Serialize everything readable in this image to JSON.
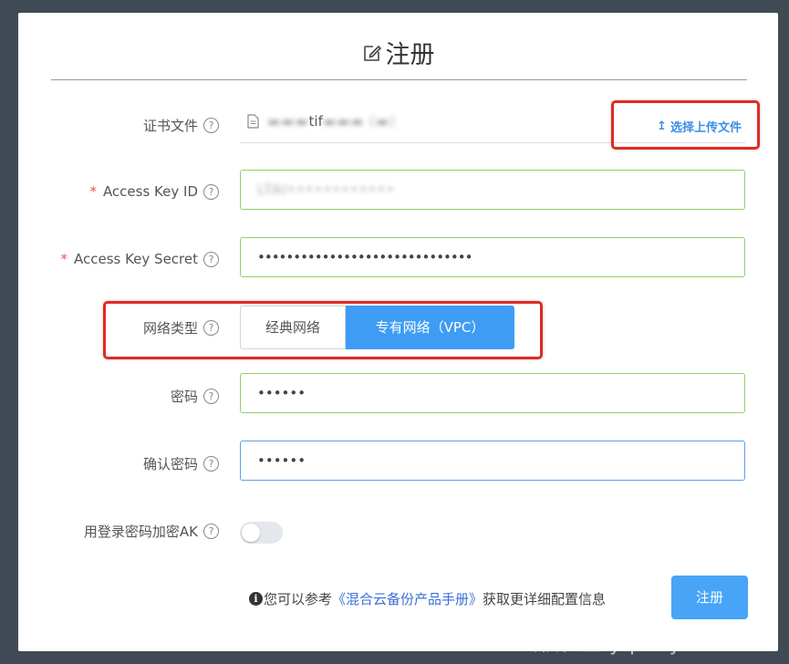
{
  "dialog": {
    "title": "注册",
    "title_icon": "edit-icon"
  },
  "form": {
    "cert": {
      "label": "证书文件",
      "file_name_visible": "tif",
      "upload_label": "选择上传文件"
    },
    "access_key_id": {
      "label": "Access Key ID",
      "required": "*",
      "value_masked": "LTAI••••••••••••"
    },
    "access_key_secret": {
      "label": "Access Key Secret",
      "required": "*",
      "value": "••••••••••••••••••••••••••••••"
    },
    "network": {
      "label": "网络类型",
      "options": [
        "经典网络",
        "专有网络（VPC）"
      ],
      "selected": "专有网络（VPC）"
    },
    "password": {
      "label": "密码",
      "value": "••••••"
    },
    "confirm_password": {
      "label": "确认密码",
      "value": "••••••"
    },
    "encrypt_ak": {
      "label": "用登录密码加密AK",
      "enabled": false
    },
    "help_symbol": "?"
  },
  "footer": {
    "info_icon": "i",
    "info_prefix": "您可以参考",
    "manual_link": "《混合云备份产品手册》",
    "info_suffix": "获取更详细配置信息",
    "submit_label": "注册"
  },
  "watermark": "云栖社区 yq.aliyun.com",
  "colors": {
    "primary": "#3e9cf5",
    "valid_border": "#8fd06a",
    "focus_border": "#5aa0e6",
    "highlight_box": "#e02a22"
  }
}
